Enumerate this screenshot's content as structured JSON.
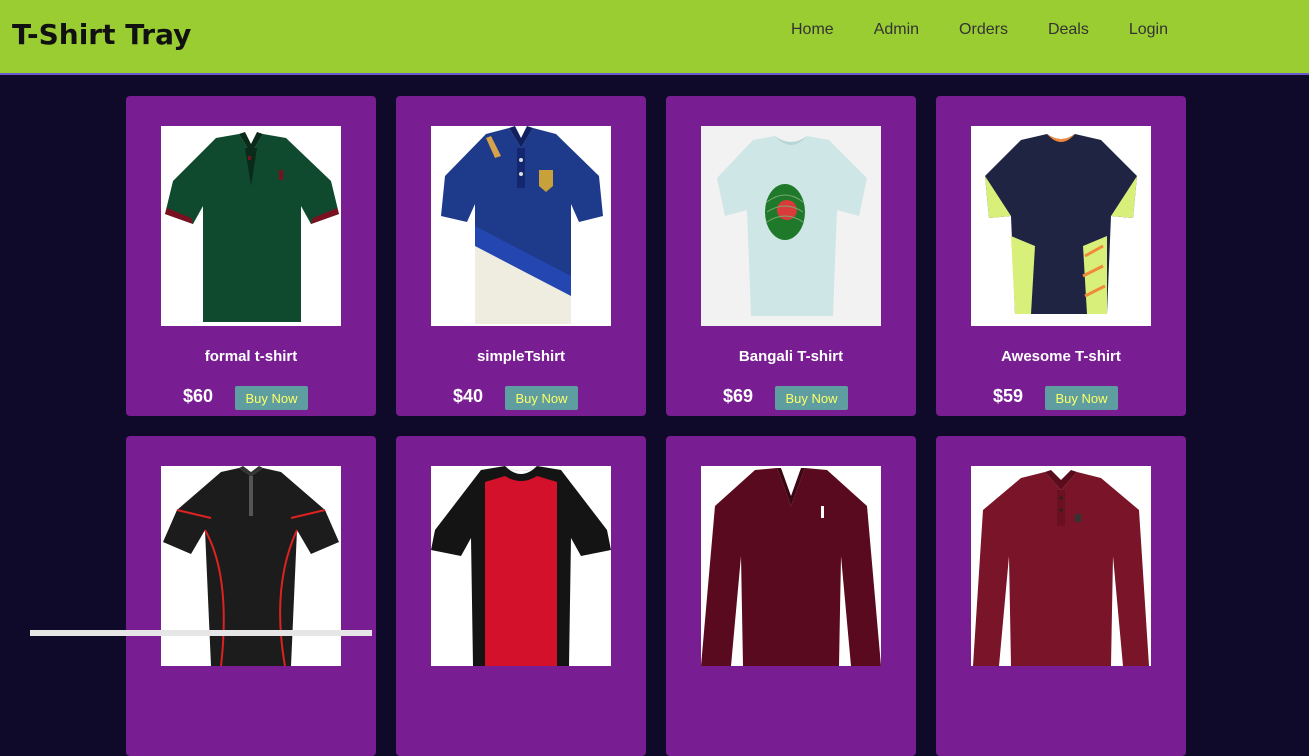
{
  "brand": "T-Shirt Tray",
  "nav": {
    "home": "Home",
    "admin": "Admin",
    "orders": "Orders",
    "deals": "Deals",
    "login": "Login"
  },
  "products": [
    {
      "name": "formal t-shirt",
      "price": "$60",
      "button": "Buy Now",
      "image": "green-polo-shirt"
    },
    {
      "name": "simpleTshirt",
      "price": "$40",
      "button": "Buy Now",
      "image": "blue-white-polo-shirt"
    },
    {
      "name": "Bangali T-shirt",
      "price": "$69",
      "button": "Buy Now",
      "image": "light-tee-flag-fingerprint"
    },
    {
      "name": "Awesome T-shirt",
      "price": "$59",
      "button": "Buy Now",
      "image": "navy-lime-sports-jersey"
    },
    {
      "name": "",
      "price": "",
      "button": "",
      "image": "black-compression-shirt"
    },
    {
      "name": "",
      "price": "",
      "button": "",
      "image": "red-black-tee"
    },
    {
      "name": "",
      "price": "",
      "button": "",
      "image": "maroon-vneck-sweater"
    },
    {
      "name": "",
      "price": "",
      "button": "",
      "image": "maroon-long-sleeve-polo"
    }
  ],
  "colors": {
    "navbar": "#9acd32",
    "page_bg": "#0f0a2a",
    "card": "#781e92",
    "button": "#5f9ea0",
    "button_text": "#ffff66"
  }
}
